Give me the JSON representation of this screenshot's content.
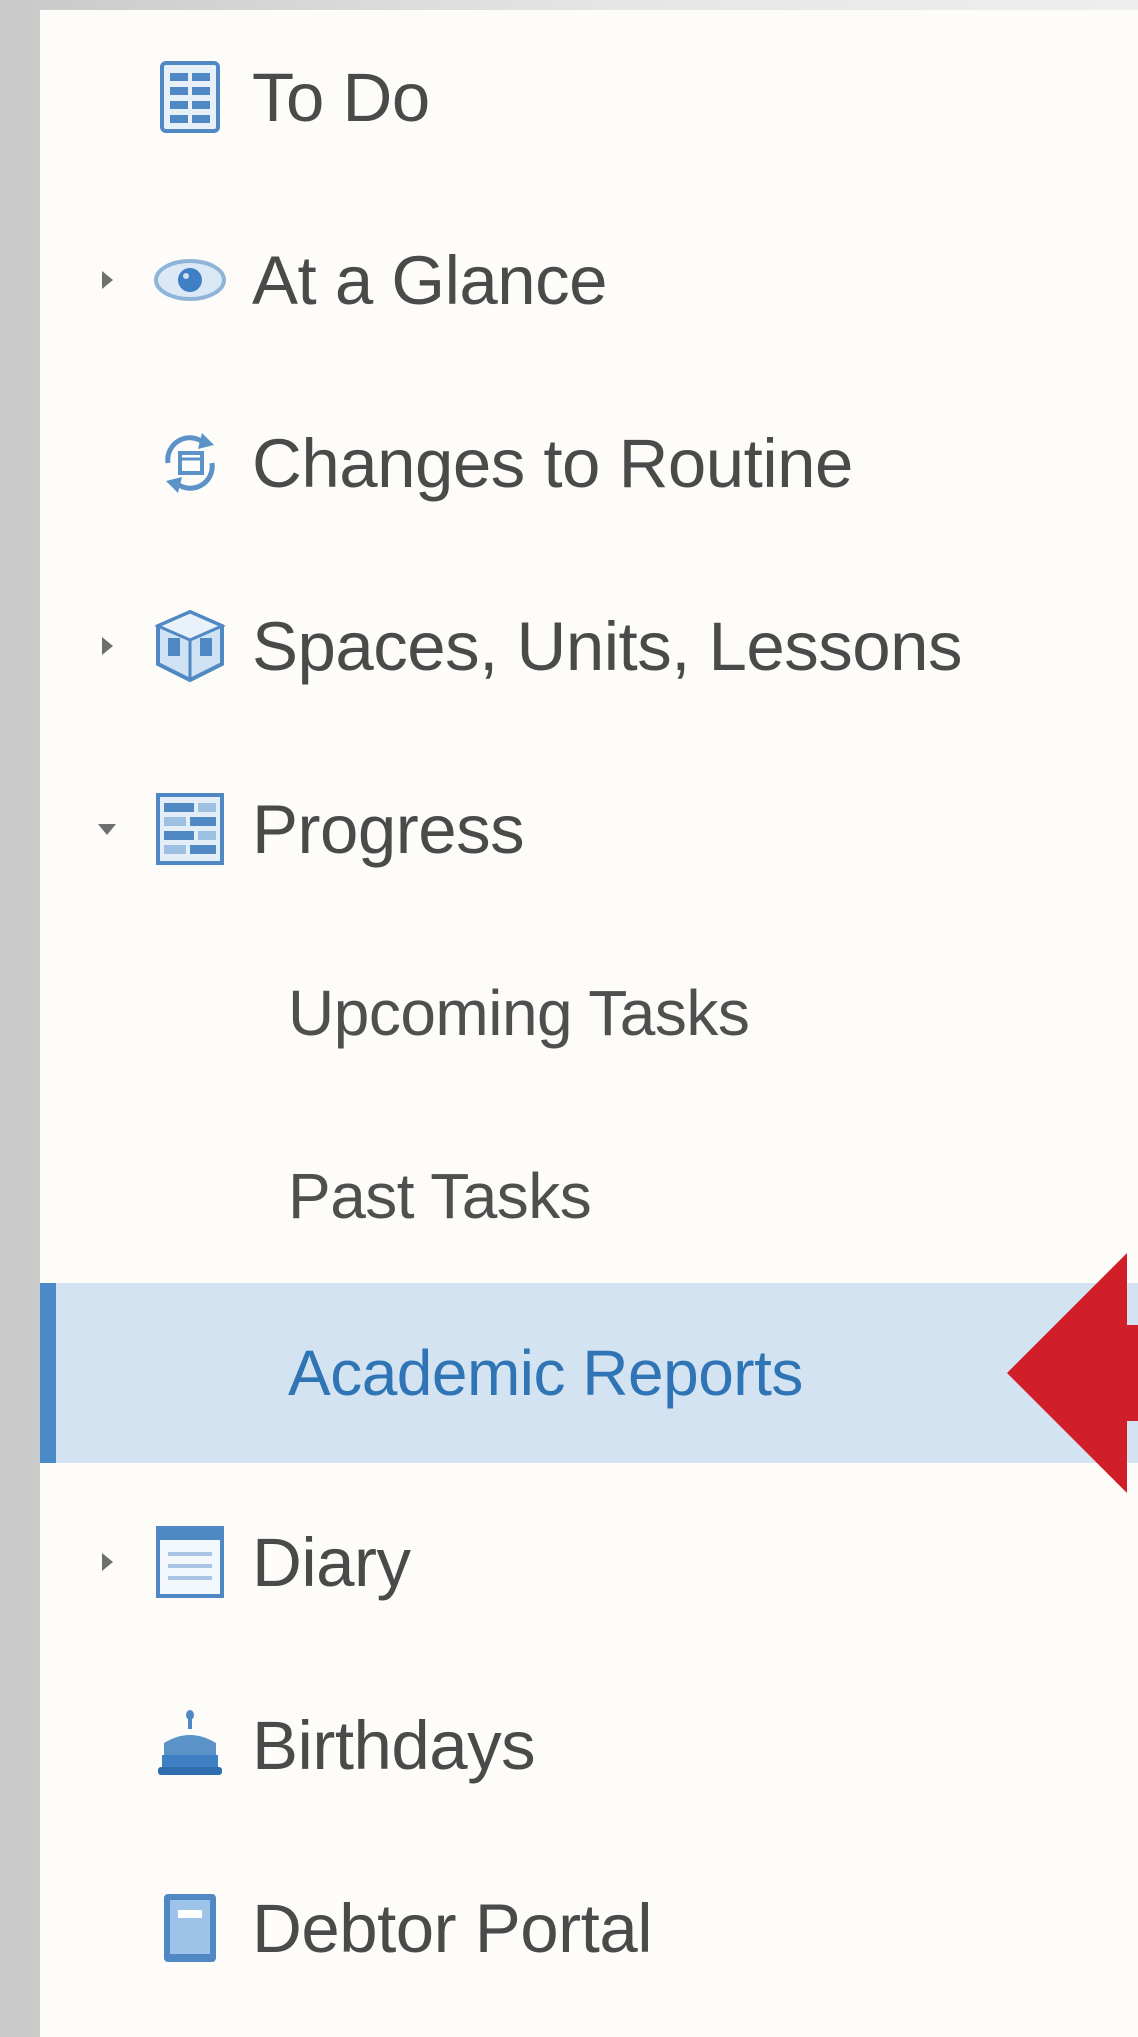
{
  "nav": {
    "items": [
      {
        "label": "To Do",
        "icon": "todo-list-icon"
      },
      {
        "label": "At a Glance",
        "icon": "eye-icon"
      },
      {
        "label": "Changes to Routine",
        "icon": "rotate-icon"
      },
      {
        "label": "Spaces, Units, Lessons",
        "icon": "cube-icon"
      },
      {
        "label": "Progress",
        "icon": "progress-grid-icon"
      },
      {
        "label": "Diary",
        "icon": "diary-icon"
      },
      {
        "label": "Birthdays",
        "icon": "cake-icon"
      },
      {
        "label": "Debtor Portal",
        "icon": "book-icon"
      }
    ],
    "sub_items": [
      {
        "label": "Upcoming Tasks"
      },
      {
        "label": "Past Tasks"
      },
      {
        "label": "Academic Reports"
      }
    ]
  },
  "colors": {
    "active_background": "#d3e3f1",
    "active_text": "#2f74b4",
    "active_bar": "#4a8ac7",
    "arrow": "#d11f2a"
  }
}
